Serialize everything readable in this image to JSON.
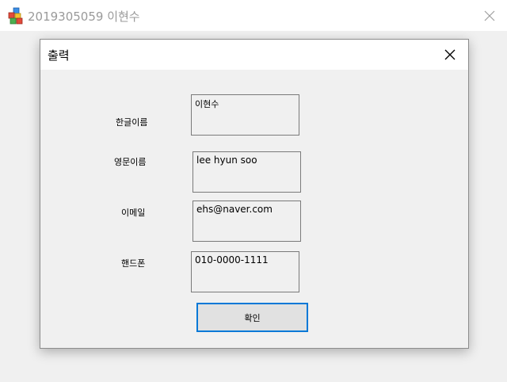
{
  "window": {
    "title": "2019305059 이현수",
    "icon": "app-icon",
    "close_icon": "close-icon"
  },
  "dialog": {
    "title": "출력",
    "close_icon": "close-icon",
    "fields": [
      {
        "label": "한글이름",
        "value": "이현수"
      },
      {
        "label": "영문이름",
        "value": "lee hyun soo"
      },
      {
        "label": "이메일",
        "value": "ehs@naver.com"
      },
      {
        "label": "핸드폰",
        "value": "010-0000-1111"
      }
    ],
    "ok_button": "확인",
    "colors": {
      "focus_border": "#0078d7",
      "button_face": "#e1e1e1",
      "dialog_background": "#f0f0f0"
    }
  }
}
